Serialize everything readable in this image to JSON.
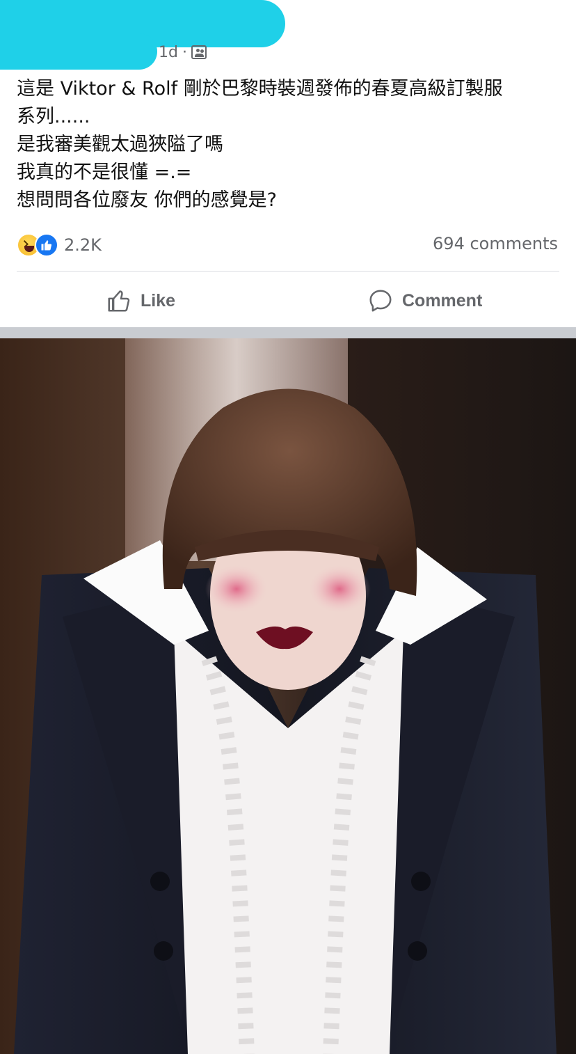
{
  "post": {
    "timestamp": "1d",
    "separator": "·",
    "audience_icon": "friends-icon",
    "text_lines": [
      "這是 Viktor & Rolf 剛於巴黎時裝週發佈的春夏高級訂製服",
      "系列......",
      "是我審美觀太過狹隘了嗎",
      "我真的不是很懂 =.=",
      "想問問各位廢友  你們的感覺是?"
    ],
    "reactions": {
      "icons": [
        "haha-emoji",
        "like-emoji"
      ],
      "count": "2.2K"
    },
    "comments_count": "694 comments"
  },
  "actions": {
    "like_label": "Like",
    "comment_label": "Comment"
  },
  "colors": {
    "redaction": "#1fd0e8",
    "meta_gray": "#65676b",
    "like_blue": "#1877f2"
  }
}
